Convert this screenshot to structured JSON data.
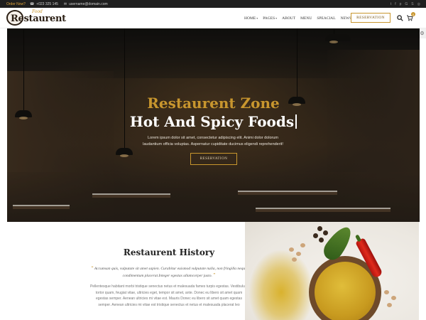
{
  "topbar": {
    "order_label": "Order Now?",
    "phone": "+023 325 145",
    "email": "username@domain.com",
    "socials": [
      "twitter-icon",
      "facebook-icon",
      "pinterest-icon",
      "google-icon",
      "skype-icon",
      "instagram-icon"
    ]
  },
  "header": {
    "logo_script": "Food",
    "logo_word": "Restaurent",
    "nav": [
      {
        "label": "HOME",
        "dropdown": true
      },
      {
        "label": "PAGES",
        "dropdown": true
      },
      {
        "label": "ABOUT",
        "dropdown": false
      },
      {
        "label": "MENU",
        "dropdown": false
      },
      {
        "label": "SPEACIAL",
        "dropdown": false
      },
      {
        "label": "NEWS",
        "dropdown": false
      }
    ],
    "reservation_label": "RESERVATION",
    "cart_count": "0"
  },
  "hero": {
    "title_line1": "Restaurent Zone",
    "title_line2": "Hot And Spicy Foods",
    "description": "Lorem ipsum dolor sit amet, consectetur adipiscing elit. Animi dolor dolorum laudantium officia voluptas. Aspernatur cupiditate ducimus eligendi reprehenderit!",
    "button_label": "RESERVATION"
  },
  "history": {
    "title": "Restaurent History",
    "quote": "Accumsan quis, vulputate sit amet sapien. Curabitur euismod vulputate nulla, non fringilla neque condimentum placerat.Integer egestas ullamcorper justo.",
    "body": "Pellentesque habitant morbi tristique senectus netus et malesuada fames turpis egestas. Vestibulum tortor quam, feugiat vitae, ultricies eget, tempor sit amet, ante. Donec eu libero sit amet quam egestas semper. Aenean ultricies mi vitae est. Mauris Donec eu libero sit amet quam egestas semper. Aenean ultricies mi vitae est tristique senectus et netus et malesuada placerat leo"
  },
  "colors": {
    "accent": "#c8962e",
    "topbar_bg": "#1f1f1f",
    "hero_title": "#ffffff",
    "text_dark": "#222222"
  }
}
